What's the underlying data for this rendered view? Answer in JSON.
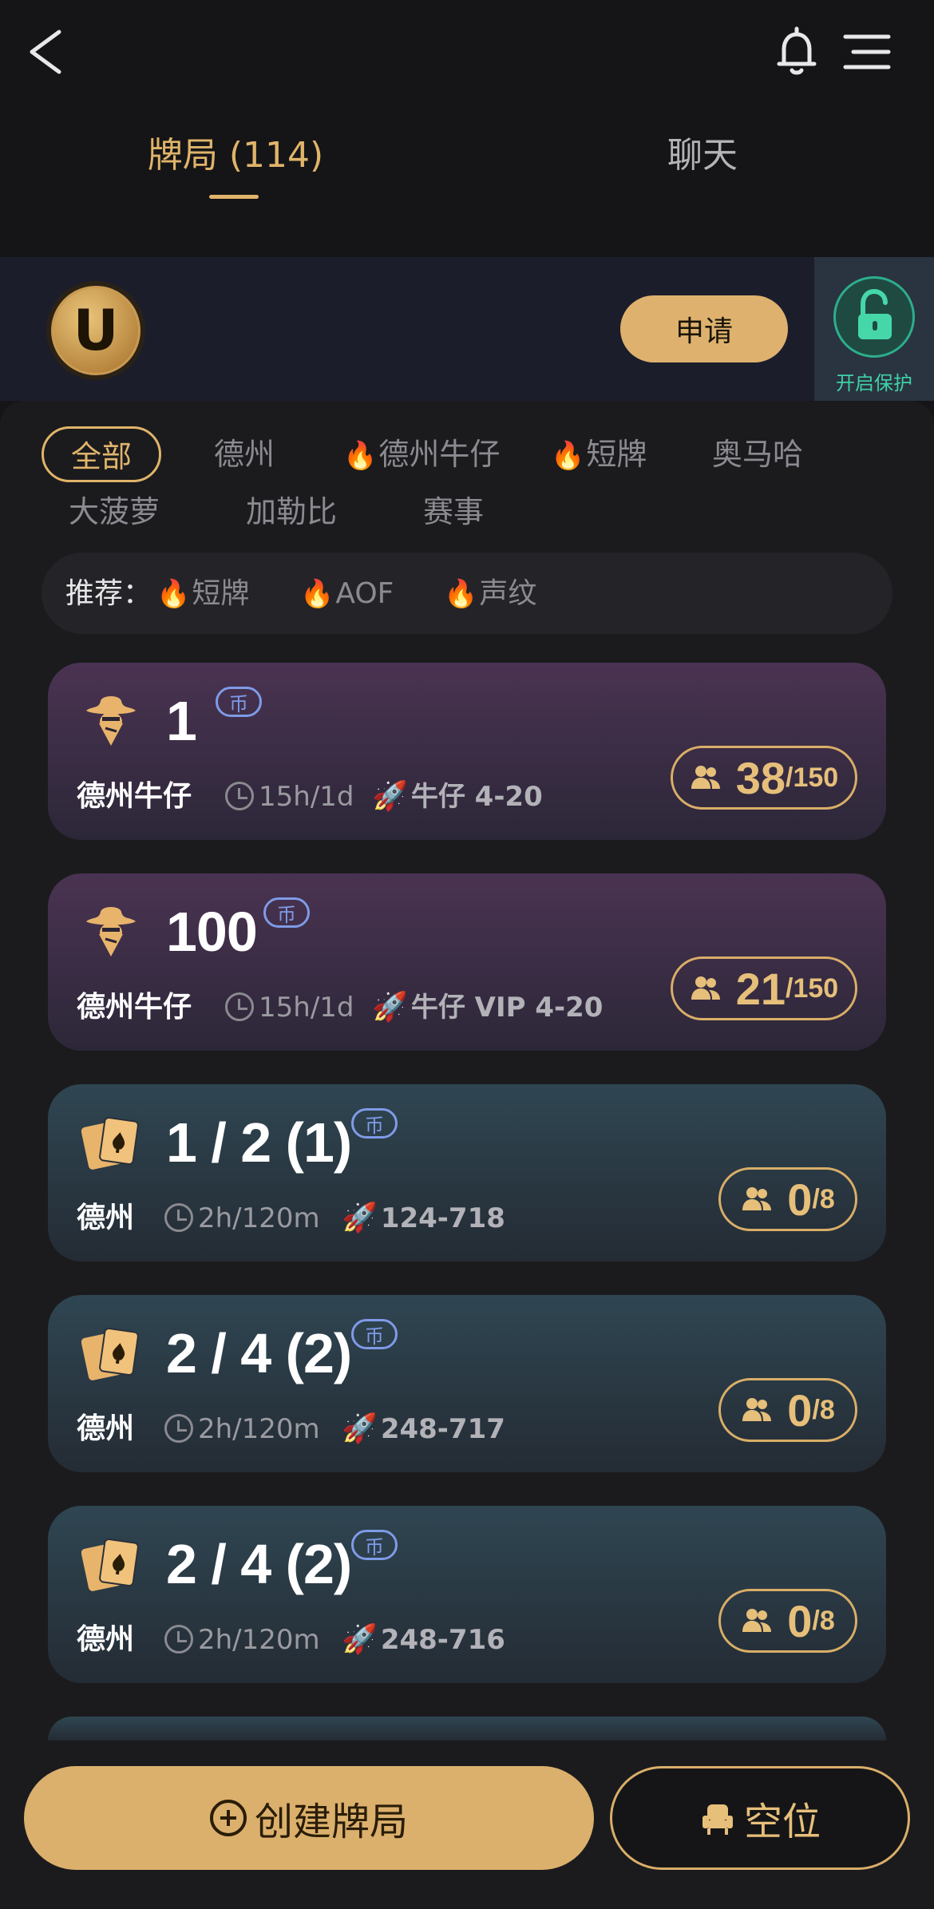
{
  "header": {
    "tabs": [
      {
        "label": "牌局 (114)",
        "active": true
      },
      {
        "label": "聊天",
        "active": false
      }
    ]
  },
  "club": {
    "logo_letter": "U",
    "apply_label": "申请",
    "protect_label": "开启保护"
  },
  "filters": [
    {
      "label": "全部",
      "active": true,
      "hot": false
    },
    {
      "label": "德州",
      "active": false,
      "hot": false
    },
    {
      "label": "德州牛仔",
      "active": false,
      "hot": true
    },
    {
      "label": "短牌",
      "active": false,
      "hot": true
    },
    {
      "label": "奥马哈",
      "active": false,
      "hot": false
    },
    {
      "label": "大菠萝",
      "active": false,
      "hot": false
    },
    {
      "label": "加勒比",
      "active": false,
      "hot": false
    },
    {
      "label": "赛事",
      "active": false,
      "hot": false
    }
  ],
  "recommend": {
    "title": "推荐：",
    "items": [
      "短牌",
      "AOF",
      "声纹"
    ]
  },
  "coin_label": "币",
  "tables": [
    {
      "title": "1",
      "type": "德州牛仔",
      "time": "15h/1d",
      "speed": "牛仔 4-20",
      "seated": "38",
      "capacity": "/150",
      "theme": "purple",
      "icon": "cowboy-icon"
    },
    {
      "title": "100",
      "type": "德州牛仔",
      "time": "15h/1d",
      "speed": "牛仔 VIP 4-20",
      "seated": "21",
      "capacity": "/150",
      "theme": "purple",
      "icon": "cowboy-icon"
    },
    {
      "title": "1 / 2 (1)",
      "type": "德州",
      "time": "2h/120m",
      "speed": "124-718",
      "seated": "0",
      "capacity": "/8",
      "theme": "teal",
      "icon": "cards-icon"
    },
    {
      "title": "2 / 4 (2)",
      "type": "德州",
      "time": "2h/120m",
      "speed": "248-717",
      "seated": "0",
      "capacity": "/8",
      "theme": "teal",
      "icon": "cards-icon"
    },
    {
      "title": "2 / 4 (2)",
      "type": "德州",
      "time": "2h/120m",
      "speed": "248-716",
      "seated": "0",
      "capacity": "/8",
      "theme": "teal",
      "icon": "cards-icon"
    }
  ],
  "bottom": {
    "create_label": "创建牌局",
    "empty_label": "空位"
  },
  "colors": {
    "accent": "#e0b46a",
    "background": "#151517",
    "coin_badge": "#7f9be8",
    "protect": "#3fd2a6",
    "hot": "#ff4b3a"
  }
}
